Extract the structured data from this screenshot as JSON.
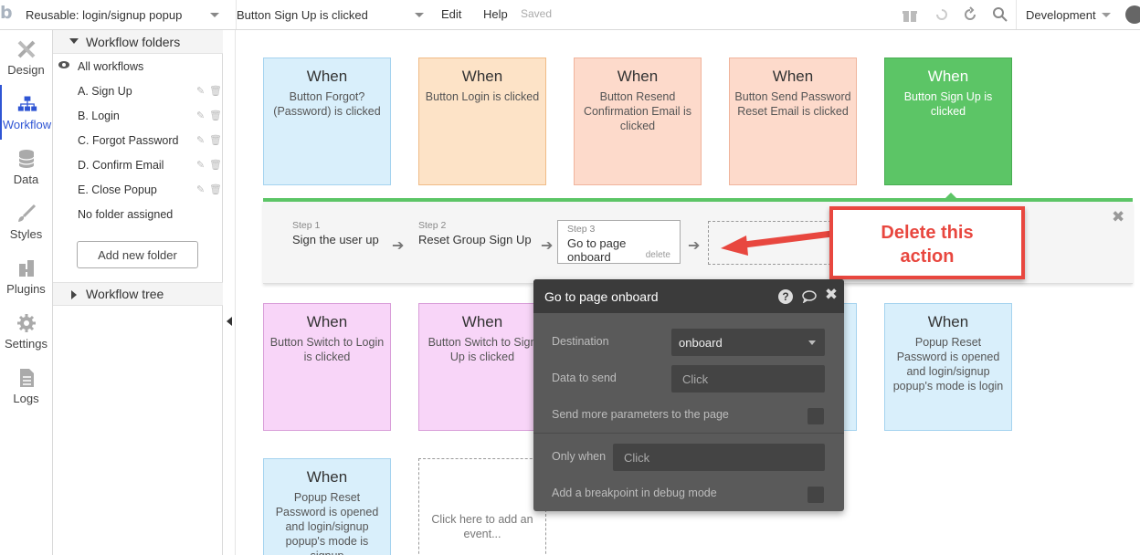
{
  "topbar": {
    "logo": "b",
    "page_select": "Reusable: login/signup popup",
    "workflow_select": "Button Sign Up is clicked",
    "edit_label": "Edit",
    "help_label": "Help",
    "saved_label": "Saved",
    "env_select": "Development"
  },
  "nav": {
    "design": "Design",
    "workflow": "Workflow",
    "data": "Data",
    "styles": "Styles",
    "plugins": "Plugins",
    "settings": "Settings",
    "logs": "Logs"
  },
  "folders": {
    "header": "Workflow folders",
    "all": "All workflows",
    "items": [
      "A. Sign Up",
      "B. Login",
      "C. Forgot Password",
      "D. Confirm Email",
      "E. Close Popup"
    ],
    "none": "No folder assigned",
    "add_button": "Add new folder",
    "tree": "Workflow tree"
  },
  "cards": [
    {
      "when": "When",
      "desc": "Button Forgot? (Password) is clicked"
    },
    {
      "when": "When",
      "desc": "Button Login is clicked"
    },
    {
      "when": "When",
      "desc": "Button Resend Confirmation Email is clicked"
    },
    {
      "when": "When",
      "desc": "Button Send Password Reset Email is clicked"
    },
    {
      "when": "When",
      "desc": "Button Sign Up is clicked"
    },
    {
      "when": "When",
      "desc": "Button Switch to Login is clicked"
    },
    {
      "when": "When",
      "desc": "Button Switch to Sign Up is clicked"
    },
    {
      "when": "When",
      "desc": "Popup Reset Password is opened and login/signup popup's mode is login"
    },
    {
      "when": "When",
      "desc": "Popup Reset Password is opened and login/signup popup's mode is signup"
    },
    {
      "when": "",
      "desc": "Click here to add an event..."
    }
  ],
  "steps": [
    {
      "num": "Step 1",
      "name": "Sign the user up"
    },
    {
      "num": "Step 2",
      "name": "Reset Group Sign Up"
    },
    {
      "num": "Step 3",
      "name": "Go to page onboard",
      "delete": "delete"
    }
  ],
  "callout": {
    "line1": "Delete this",
    "line2": "action",
    "color": "#e8473f"
  },
  "popup": {
    "title": "Go to page onboard",
    "destination_label": "Destination",
    "destination_value": "onboard",
    "data_label": "Data to send",
    "data_placeholder": "Click",
    "more_params_label": "Send more parameters to the page",
    "only_when_label": "Only when",
    "only_when_placeholder": "Click",
    "breakpoint_label": "Add a breakpoint in debug mode"
  },
  "colors": {
    "accent": "#2f55d4",
    "green": "#5cc566",
    "red": "#e8473f"
  }
}
